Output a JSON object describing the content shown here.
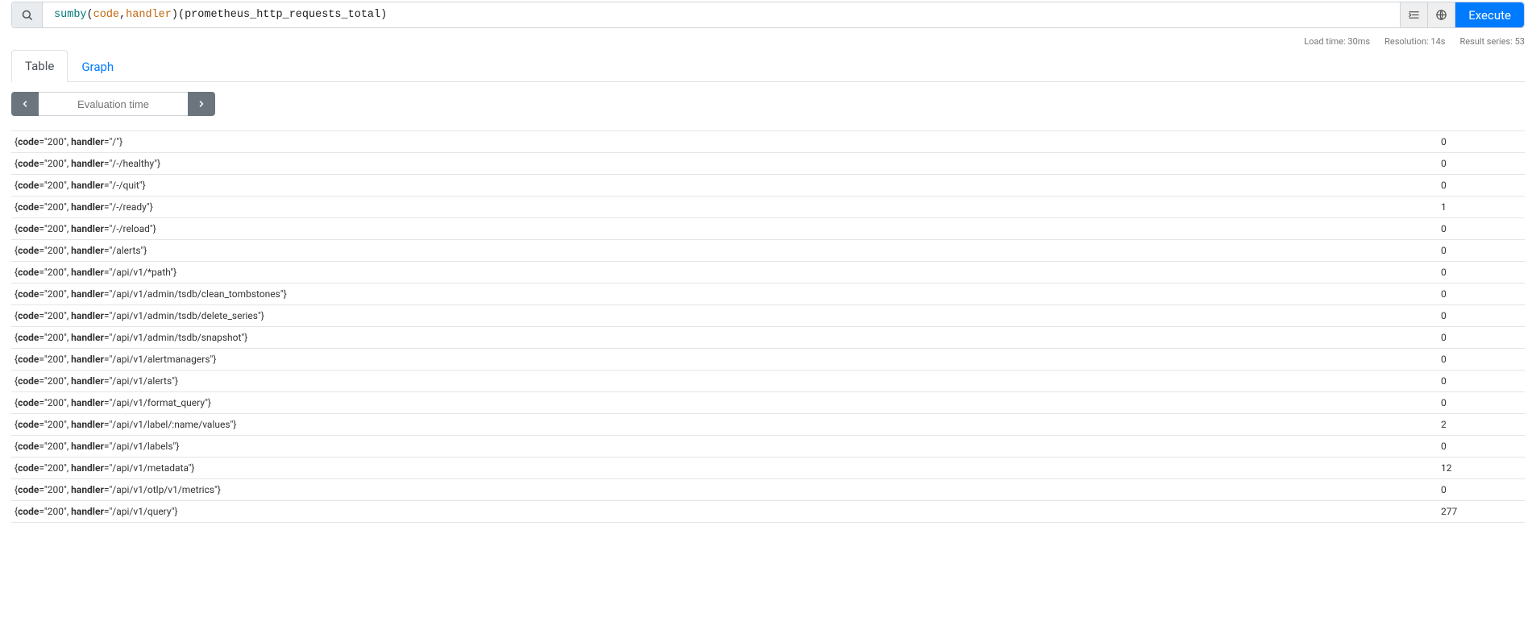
{
  "query": {
    "tokens": [
      {
        "t": "sum",
        "c": "kw1"
      },
      {
        "t": " ",
        "c": ""
      },
      {
        "t": "by",
        "c": "kw1"
      },
      {
        "t": " ",
        "c": ""
      },
      {
        "t": "(",
        "c": "paren"
      },
      {
        "t": "code",
        "c": "label"
      },
      {
        "t": ",",
        "c": "paren"
      },
      {
        "t": "handler",
        "c": "label"
      },
      {
        "t": ")",
        "c": "paren"
      },
      {
        "t": " ",
        "c": ""
      },
      {
        "t": "(",
        "c": "br"
      },
      {
        "t": "prometheus_http_requests_total",
        "c": "metric"
      },
      {
        "t": ")",
        "c": "br"
      }
    ]
  },
  "execute_label": "Execute",
  "stats": {
    "load_time": "Load time: 30ms",
    "resolution": "Resolution: 14s",
    "result_series": "Result series: 53"
  },
  "tabs": {
    "table": "Table",
    "graph": "Graph"
  },
  "eval_placeholder": "Evaluation time",
  "results": [
    {
      "code": "200",
      "handler": "/",
      "value": "0"
    },
    {
      "code": "200",
      "handler": "/-/healthy",
      "value": "0"
    },
    {
      "code": "200",
      "handler": "/-/quit",
      "value": "0"
    },
    {
      "code": "200",
      "handler": "/-/ready",
      "value": "1"
    },
    {
      "code": "200",
      "handler": "/-/reload",
      "value": "0"
    },
    {
      "code": "200",
      "handler": "/alerts",
      "value": "0"
    },
    {
      "code": "200",
      "handler": "/api/v1/*path",
      "value": "0"
    },
    {
      "code": "200",
      "handler": "/api/v1/admin/tsdb/clean_tombstones",
      "value": "0"
    },
    {
      "code": "200",
      "handler": "/api/v1/admin/tsdb/delete_series",
      "value": "0"
    },
    {
      "code": "200",
      "handler": "/api/v1/admin/tsdb/snapshot",
      "value": "0"
    },
    {
      "code": "200",
      "handler": "/api/v1/alertmanagers",
      "value": "0"
    },
    {
      "code": "200",
      "handler": "/api/v1/alerts",
      "value": "0"
    },
    {
      "code": "200",
      "handler": "/api/v1/format_query",
      "value": "0"
    },
    {
      "code": "200",
      "handler": "/api/v1/label/:name/values",
      "value": "2"
    },
    {
      "code": "200",
      "handler": "/api/v1/labels",
      "value": "0"
    },
    {
      "code": "200",
      "handler": "/api/v1/metadata",
      "value": "12"
    },
    {
      "code": "200",
      "handler": "/api/v1/otlp/v1/metrics",
      "value": "0"
    },
    {
      "code": "200",
      "handler": "/api/v1/query",
      "value": "277"
    }
  ]
}
